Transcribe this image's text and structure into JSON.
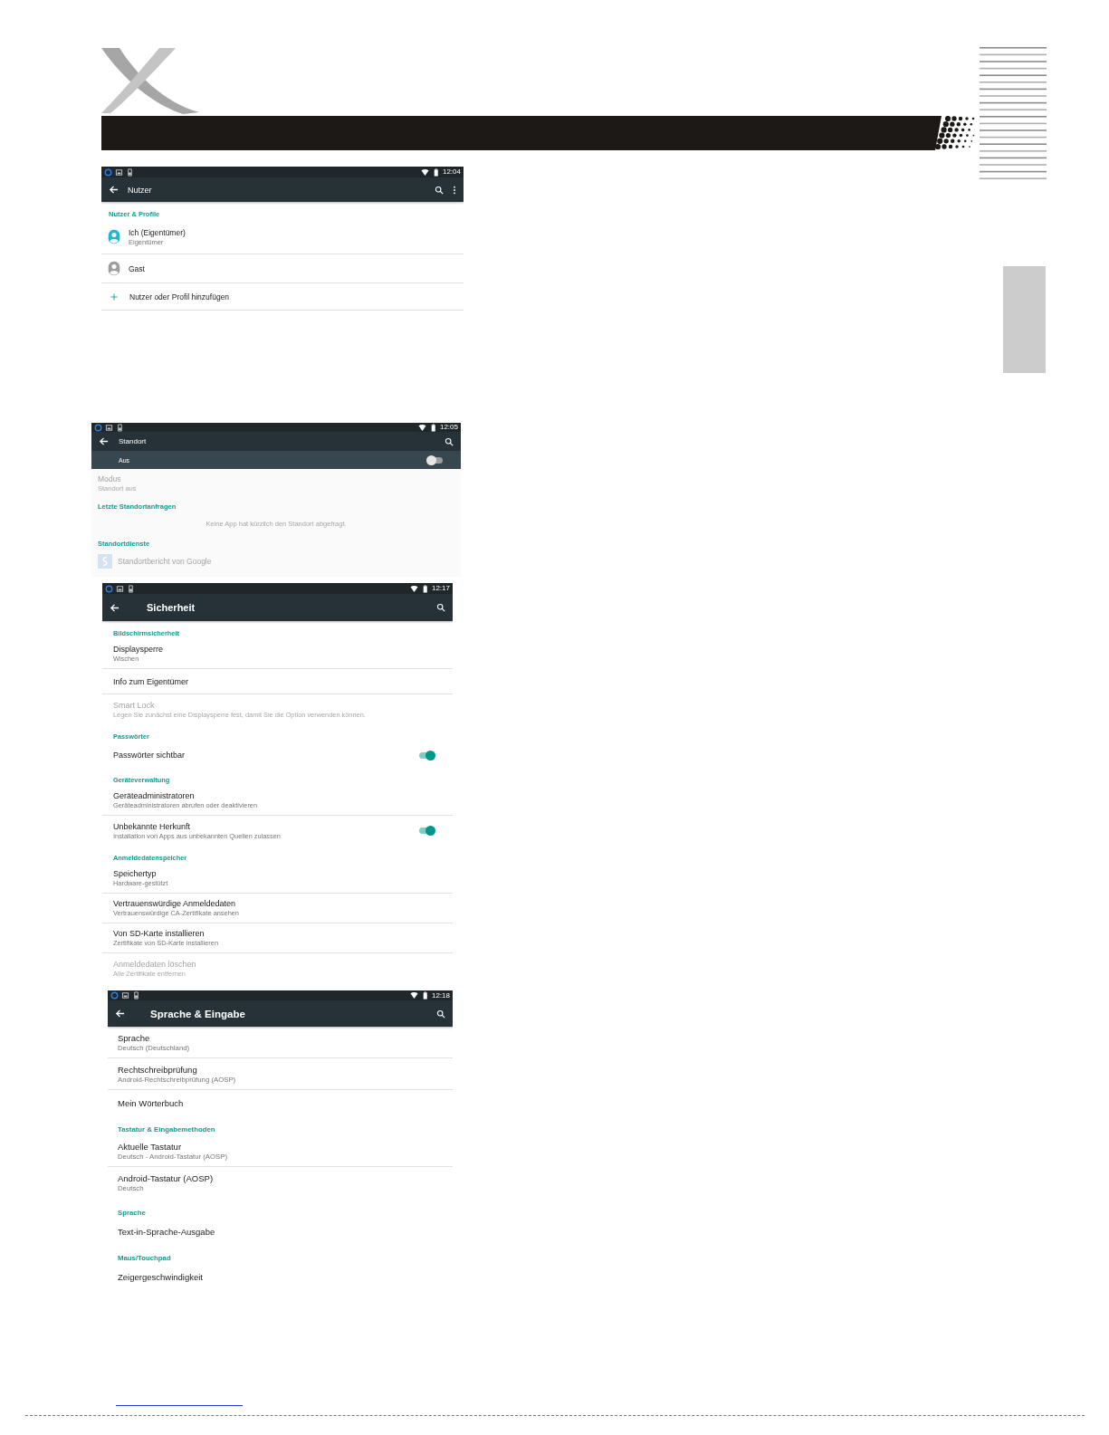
{
  "screens": [
    {
      "status_time": "12:04",
      "title": "Nutzer",
      "actions": [
        {
          "kind": "search"
        },
        {
          "kind": "more"
        }
      ],
      "items": [
        {
          "kind": "header",
          "text": "Nutzer & Profile"
        },
        {
          "kind": "avatar",
          "title": "Ich (Eigentümer)",
          "summary": "Eigentümer",
          "color": "#1fb5d6",
          "disabled": false
        },
        {
          "kind": "avatar",
          "title": "Gast",
          "color": "#9e9e9e",
          "disabled": false
        },
        {
          "kind": "add",
          "title": "Nutzer oder Profil hinzufügen",
          "disabled": false
        }
      ]
    },
    {
      "status_time": "12:05",
      "title": "Standort",
      "actions": [
        {
          "kind": "search"
        }
      ],
      "master_switch": {
        "label": "Aus",
        "on": false
      },
      "items": [
        {
          "kind": "setting",
          "title": "Modus",
          "summary": "Standort aus",
          "disabled": true
        },
        {
          "kind": "header",
          "text": "Letzte Standortanfragen"
        },
        {
          "kind": "note",
          "text": "Keine App hat kürzlich den Standort abgefragt."
        },
        {
          "kind": "header",
          "text": "Standortdienste"
        },
        {
          "kind": "app",
          "title": "Standortbericht von Google",
          "disabled": true
        }
      ]
    },
    {
      "status_time": "12:17",
      "title": "Sicherheit",
      "actions": [
        {
          "kind": "search"
        }
      ],
      "items": [
        {
          "kind": "header",
          "text": "Bildschirmsicherheit"
        },
        {
          "kind": "setting",
          "title": "Displaysperre",
          "summary": "Wischen",
          "disabled": false
        },
        {
          "kind": "setting",
          "title": "Info zum Eigentümer",
          "disabled": false
        },
        {
          "kind": "setting",
          "title": "Smart Lock",
          "summary": "Legen Sie zunächst eine Displaysperre fest, damit Sie die Option verwenden können.",
          "disabled": true
        },
        {
          "kind": "header",
          "text": "Passwörter"
        },
        {
          "kind": "setting",
          "title": "Passwörter sichtbar",
          "disabled": false,
          "on": true
        },
        {
          "kind": "header",
          "text": "Geräteverwaltung"
        },
        {
          "kind": "setting",
          "title": "Geräteadministratoren",
          "summary": "Geräteadministratoren abrufen oder deaktivieren",
          "disabled": false
        },
        {
          "kind": "setting",
          "title": "Unbekannte Herkunft",
          "summary": "Installation von Apps aus unbekannten Quellen zulassen",
          "disabled": false,
          "on": true
        },
        {
          "kind": "header",
          "text": "Anmeldedatenspeicher"
        },
        {
          "kind": "setting",
          "title": "Speichertyp",
          "summary": "Hardware-gestützt",
          "disabled": false
        },
        {
          "kind": "setting",
          "title": "Vertrauenswürdige Anmeldedaten",
          "summary": "Vertrauenswürdige CA-Zertifikate ansehen",
          "disabled": false
        },
        {
          "kind": "setting",
          "title": "Von SD-Karte installieren",
          "summary": "Zertifikate von SD-Karte installieren",
          "disabled": false
        },
        {
          "kind": "setting",
          "title": "Anmeldedaten löschen",
          "summary": "Alle Zertifikate entfernen",
          "disabled": true
        }
      ]
    },
    {
      "status_time": "12:18",
      "title": "Sprache & Eingabe",
      "actions": [
        {
          "kind": "search"
        }
      ],
      "items": [
        {
          "kind": "setting",
          "title": "Sprache",
          "summary": "Deutsch (Deutschland)",
          "disabled": false
        },
        {
          "kind": "setting",
          "title": "Rechtschreibprüfung",
          "summary": "Android-Rechtschreibprüfung (AOSP)",
          "disabled": false
        },
        {
          "kind": "setting",
          "title": "Mein Wörterbuch",
          "disabled": false
        },
        {
          "kind": "header",
          "text": "Tastatur & Eingabemethoden"
        },
        {
          "kind": "setting",
          "title": "Aktuelle Tastatur",
          "summary": "Deutsch - Android-Tastatur (AOSP)",
          "disabled": false
        },
        {
          "kind": "setting",
          "title": "Android-Tastatur (AOSP)",
          "summary": "Deutsch",
          "disabled": false
        },
        {
          "kind": "header",
          "text": "Sprache"
        },
        {
          "kind": "setting",
          "title": "Text-in-Sprache-Ausgabe",
          "disabled": false
        },
        {
          "kind": "header",
          "text": "Maus/Touchpad"
        },
        {
          "kind": "setting",
          "title": "Zeigergeschwindigkeit",
          "disabled": false
        }
      ]
    }
  ]
}
